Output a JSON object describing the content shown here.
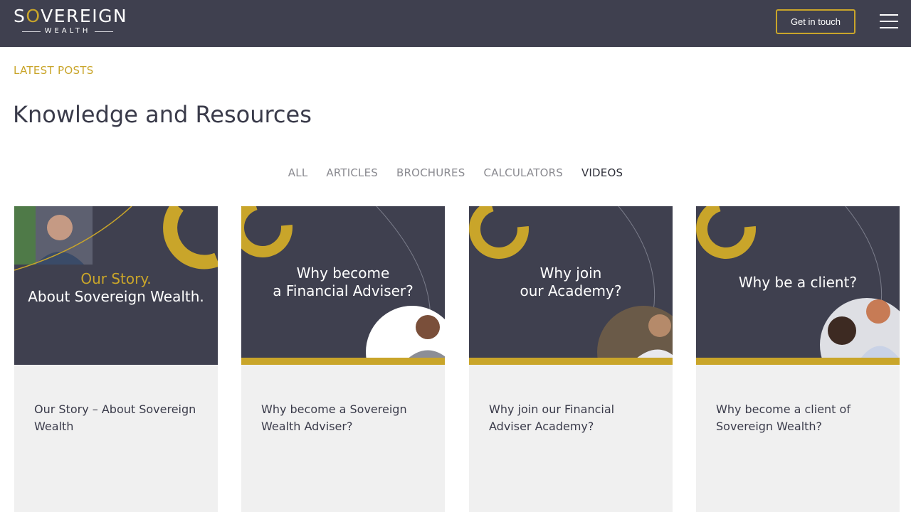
{
  "header": {
    "logo_main": "SOVEREIGN",
    "logo_sub": "WEALTH",
    "cta_label": "Get in touch",
    "menu_icon": "hamburger-menu-icon",
    "accent_color": "#c9a52a",
    "bar_color": "#3f404f"
  },
  "main": {
    "eyebrow": "LATEST POSTS",
    "title": "Knowledge and Resources",
    "filters": [
      "ALL",
      "ARTICLES",
      "BROCHURES",
      "CALCULATORS",
      "VIDEOS"
    ],
    "active_filter": "VIDEOS"
  },
  "cards": [
    {
      "thumb_line1": "Our Story.",
      "thumb_line2": "About Sovereign Wealth.",
      "title": "Our Story – About Sovereign Wealth"
    },
    {
      "thumb_line1": "Why become",
      "thumb_line2": "a Financial Adviser?",
      "title": "Why become a Sovereign Wealth Adviser?"
    },
    {
      "thumb_line1": "Why join",
      "thumb_line2": "our Academy?",
      "title": "Why join our Financial Adviser Academy?"
    },
    {
      "thumb_line1": "Why be a client?",
      "thumb_line2": "",
      "title": "Why become a client of Sovereign Wealth?"
    }
  ]
}
